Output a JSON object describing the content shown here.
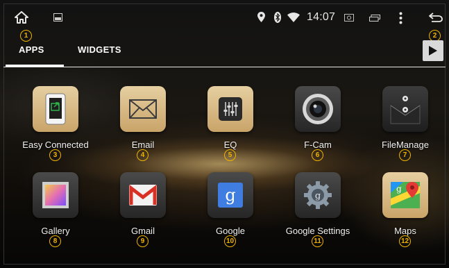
{
  "status_bar": {
    "time": "14:07",
    "icons": [
      "home-icon",
      "image-icon",
      "location-icon",
      "bluetooth-icon",
      "wifi-icon",
      "camera-icon",
      "recents-icon",
      "overflow-menu-icon",
      "back-icon"
    ]
  },
  "tabs": [
    {
      "label": "APPS",
      "active": true
    },
    {
      "label": "WIDGETS",
      "active": false
    }
  ],
  "callouts": {
    "home": "1",
    "back": "2"
  },
  "apps": [
    {
      "label": "Easy Connected",
      "badge": "3",
      "icon": "easy-connected-icon"
    },
    {
      "label": "Email",
      "badge": "4",
      "icon": "email-envelope-icon"
    },
    {
      "label": "EQ",
      "badge": "5",
      "icon": "equalizer-icon"
    },
    {
      "label": "F-Cam",
      "badge": "6",
      "icon": "camera-lens-icon"
    },
    {
      "label": "FileManage",
      "badge": "7",
      "icon": "file-manager-icon"
    },
    {
      "label": "Gallery",
      "badge": "8",
      "icon": "gallery-icon"
    },
    {
      "label": "Gmail",
      "badge": "9",
      "icon": "gmail-icon"
    },
    {
      "label": "Google",
      "badge": "10",
      "icon": "google-search-icon"
    },
    {
      "label": "Google Settings",
      "badge": "11",
      "icon": "google-settings-icon"
    },
    {
      "label": "Maps",
      "badge": "12",
      "icon": "maps-icon"
    }
  ],
  "colors": {
    "badge": "#f0b400",
    "gold_icon": "#d8bb84",
    "tab_text": "#ffffff"
  }
}
